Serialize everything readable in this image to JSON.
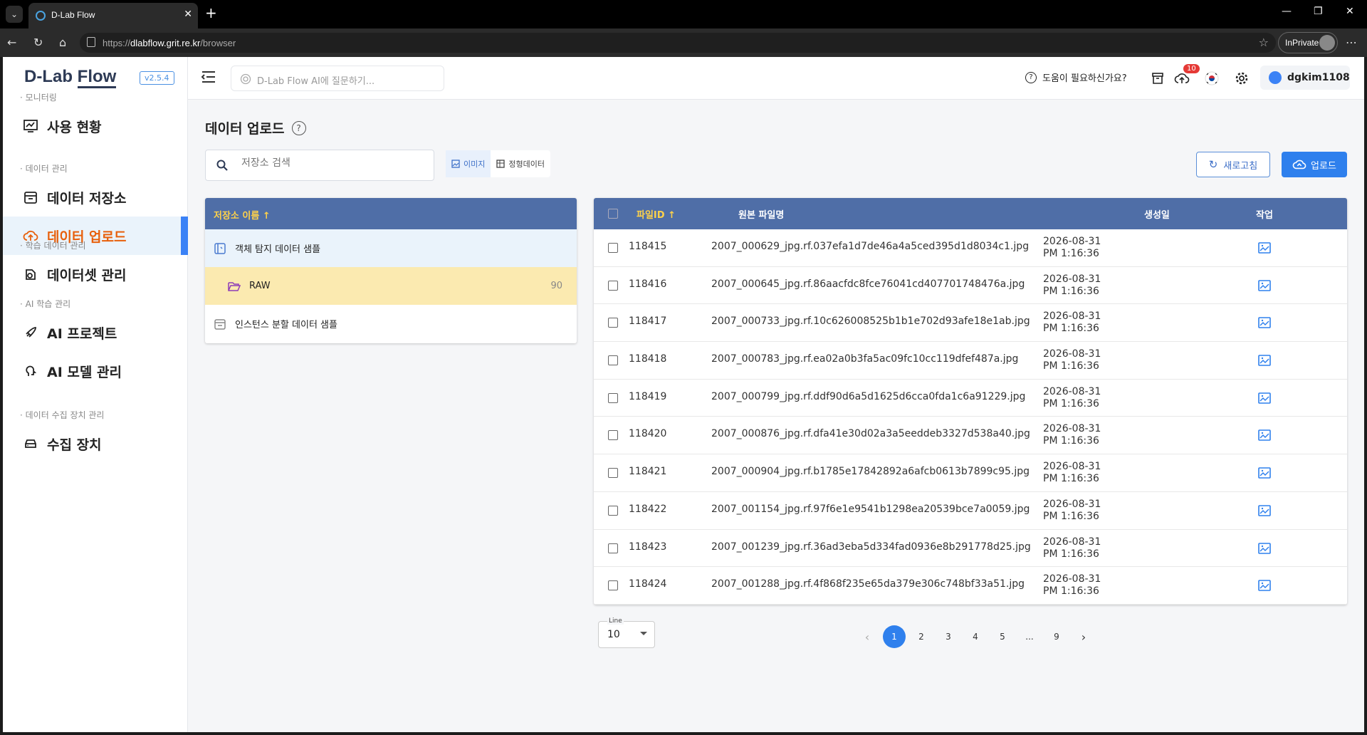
{
  "browser": {
    "tab_title": "D-Lab Flow",
    "url_prefix": "https://",
    "url_host": "dlabflow.grit.re.kr",
    "url_path": "/browser",
    "inprivate_label": "InPrivate"
  },
  "sidebar": {
    "logo_part1": "D-Lab ",
    "logo_part2": "Flow",
    "version": "v2.5.4",
    "sections": [
      {
        "label": "· 모니터링",
        "items": [
          {
            "label": "사용 현황",
            "icon": "monitor-chart-icon"
          }
        ]
      },
      {
        "label": "· 데이터 관리",
        "items": [
          {
            "label": "데이터 저장소",
            "icon": "storage-icon"
          },
          {
            "label": "데이터 업로드",
            "icon": "cloud-upload-icon",
            "active": true
          }
        ]
      },
      {
        "label": "· 학습 데이터 관리",
        "items": [
          {
            "label": "데이터셋 관리",
            "icon": "dataset-icon"
          }
        ]
      },
      {
        "label": "· AI 학습 관리",
        "items": [
          {
            "label": "AI 프로젝트",
            "icon": "rocket-icon"
          },
          {
            "label": "AI 모델 관리",
            "icon": "brain-icon"
          }
        ]
      },
      {
        "label": "· 데이터 수집 장치 관리",
        "items": [
          {
            "label": "수집 장치",
            "icon": "device-icon"
          }
        ]
      }
    ]
  },
  "header": {
    "ai_search_placeholder": "D-Lab Flow AI에 질문하기...",
    "help_label": "도움이 필요하신가요?",
    "upload_badge": "10",
    "username": "dgkim1108"
  },
  "main": {
    "page_title": "데이터 업로드",
    "repo_search_placeholder": "저장소 검색",
    "toggle_image": "이미지",
    "toggle_structured": "정형데이터",
    "refresh_label": "새로고침",
    "upload_label": "업로드",
    "tree": {
      "header": "저장소 이름 ↑",
      "rows": [
        {
          "label": "객체 탐지 데이터 샘플",
          "type": "repo"
        },
        {
          "label": "RAW",
          "type": "folder",
          "count": "90"
        },
        {
          "label": "인스턴스 분할 데이터 샘플",
          "type": "repo"
        }
      ]
    },
    "table": {
      "columns": {
        "file_id": "파일ID ↑",
        "original_name": "원본 파일명",
        "created": "생성일",
        "action": "작업"
      },
      "rows": [
        {
          "id": "118415",
          "name": "2007_000629_jpg.rf.037efa1d7de46a4a5ced395d1d8034c1.jpg",
          "date": "2026-08-31",
          "time": "PM 1:16:36"
        },
        {
          "id": "118416",
          "name": "2007_000645_jpg.rf.86aacfdc8fce76041cd407701748476a.jpg",
          "date": "2026-08-31",
          "time": "PM 1:16:36"
        },
        {
          "id": "118417",
          "name": "2007_000733_jpg.rf.10c626008525b1b1e702d93afe18e1ab.jpg",
          "date": "2026-08-31",
          "time": "PM 1:16:36"
        },
        {
          "id": "118418",
          "name": "2007_000783_jpg.rf.ea02a0b3fa5ac09fc10cc119dfef487a.jpg",
          "date": "2026-08-31",
          "time": "PM 1:16:36"
        },
        {
          "id": "118419",
          "name": "2007_000799_jpg.rf.ddf90d6a5d1625d6cca0fda1c6a91229.jpg",
          "date": "2026-08-31",
          "time": "PM 1:16:36"
        },
        {
          "id": "118420",
          "name": "2007_000876_jpg.rf.dfa41e30d02a3a5eeddeb3327d538a40.jpg",
          "date": "2026-08-31",
          "time": "PM 1:16:36"
        },
        {
          "id": "118421",
          "name": "2007_000904_jpg.rf.b1785e17842892a6afcb0613b7899c95.jpg",
          "date": "2026-08-31",
          "time": "PM 1:16:36"
        },
        {
          "id": "118422",
          "name": "2007_001154_jpg.rf.97f6e1e9541b1298ea20539bce7a0059.jpg",
          "date": "2026-08-31",
          "time": "PM 1:16:36"
        },
        {
          "id": "118423",
          "name": "2007_001239_jpg.rf.36ad3eba5d334fad0936e8b291778d25.jpg",
          "date": "2026-08-31",
          "time": "PM 1:16:36"
        },
        {
          "id": "118424",
          "name": "2007_001288_jpg.rf.4f868f235e65da379e306c748bf33a51.jpg",
          "date": "2026-08-31",
          "time": "PM 1:16:36"
        }
      ]
    },
    "pagination": {
      "line_label": "Line",
      "line_value": "10",
      "pages": [
        "1",
        "2",
        "3",
        "4",
        "5",
        "...",
        "9"
      ],
      "current": "1"
    }
  },
  "colors": {
    "accent": "#2f80ed",
    "table_header": "#4f6ea7",
    "active_nav_text": "#e8600c",
    "tree_header_text": "#ffd24a"
  }
}
